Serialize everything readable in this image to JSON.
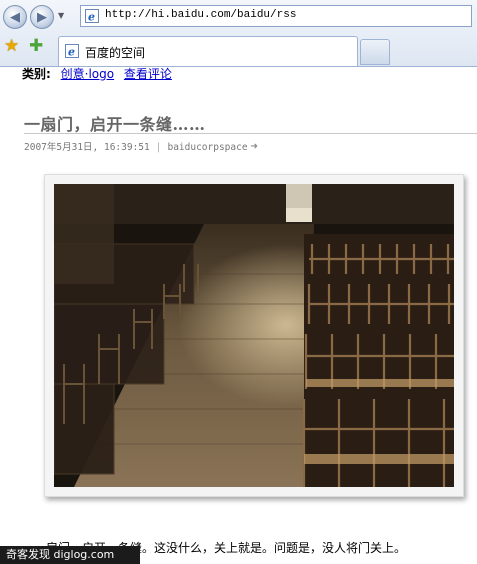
{
  "browser": {
    "url": "http://hi.baidu.com/baidu/rss",
    "tab_title": "百度的空间"
  },
  "post": {
    "category_label": "类别:",
    "category_link": "创意·logo",
    "comments_link": "查看评论",
    "title": "一扇门，启开一条缝……",
    "datetime": "2007年5月31日, 16:39:51",
    "author": "baiducorpspace",
    "body_text": "一扇门，启开一条缝。这没什么，关上就是。问题是，没人将门关上。"
  },
  "watermark": "奇客发现 diglog.com",
  "colors": {
    "link": "#0000cc",
    "title": "#666666",
    "meta": "#777777"
  }
}
